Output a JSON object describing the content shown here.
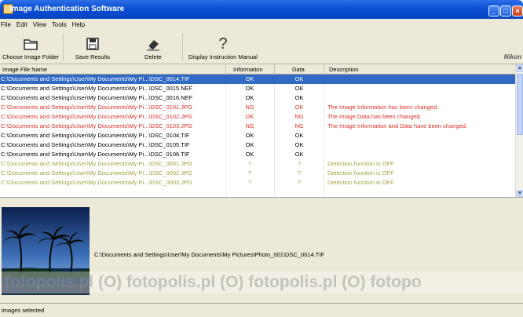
{
  "window": {
    "title": "Image Authentication Software"
  },
  "menu": [
    "File",
    "Edit",
    "View",
    "Tools",
    "Help"
  ],
  "toolbar": {
    "choose_folder": "Choose Image Folder",
    "save_results": "Save Results",
    "delete": "Delete",
    "manual": "Display Instruction Manual",
    "brand": "Nikon"
  },
  "table": {
    "columns": [
      "Image File Name",
      "Information",
      "Data",
      "Description"
    ],
    "rows": [
      {
        "name": "C:\\Documents and Settings\\User\\My Documents\\My Pi...\\DSC_0014.TIF",
        "info": "OK",
        "data": "OK",
        "desc": "",
        "status": "selected"
      },
      {
        "name": "C:\\Documents and Settings\\User\\My Documents\\My Pi...\\DSC_0015.NEF",
        "info": "OK",
        "data": "OK",
        "desc": "",
        "status": "normal"
      },
      {
        "name": "C:\\Documents and Settings\\User\\My Documents\\My Pi...\\DSC_0016.NEF",
        "info": "OK",
        "data": "OK",
        "desc": "",
        "status": "normal"
      },
      {
        "name": "C:\\Documents and Settings\\User\\My Documents\\My Pi...\\DSC_0101.JPG",
        "info": "NG",
        "data": "OK",
        "desc": "The Image Information has been changed.",
        "status": "red"
      },
      {
        "name": "C:\\Documents and Settings\\User\\My Documents\\My Pi...\\DSC_0102.JPG",
        "info": "OK",
        "data": "NG",
        "desc": "The Image Data has been changed.",
        "status": "red"
      },
      {
        "name": "C:\\Documents and Settings\\User\\My Documents\\My Pi...\\DSC_0103.JPG",
        "info": "NG",
        "data": "NG",
        "desc": "The Image Information and Data have been changed.",
        "status": "red"
      },
      {
        "name": "C:\\Documents and Settings\\User\\My Documents\\My Pi...\\DSC_0104.TIF",
        "info": "OK",
        "data": "OK",
        "desc": "",
        "status": "normal"
      },
      {
        "name": "C:\\Documents and Settings\\User\\My Documents\\My Pi...\\DSC_0105.TIF",
        "info": "OK",
        "data": "OK",
        "desc": "",
        "status": "normal"
      },
      {
        "name": "C:\\Documents and Settings\\User\\My Documents\\My Pi...\\DSC_0106.TIF",
        "info": "OK",
        "data": "OK",
        "desc": "",
        "status": "normal"
      },
      {
        "name": "C:\\Documents and Settings\\User\\My Documents\\My Pi...\\DSC_0001.JPG",
        "info": "?",
        "data": "?",
        "desc": "Detection function is OFF.",
        "status": "olive"
      },
      {
        "name": "C:\\Documents and Settings\\User\\My Documents\\My Pi...\\DSC_0002.JPG",
        "info": "?",
        "data": "?",
        "desc": "Detection function is OFF.",
        "status": "olive"
      },
      {
        "name": "C:\\Documents and Settings\\User\\My Documents\\My Pi...\\DSC_0003.JPG",
        "info": "?",
        "data": "?",
        "desc": "Detection function is OFF.",
        "status": "olive"
      }
    ]
  },
  "preview": {
    "path": "C:\\Documents and Settings\\User\\My Documents\\My Pictures\\Photo_001\\DSC_0014.TIF",
    "watermark": "fotopolis.pl  (O) fotopolis.pl  (O) fotopolis.pl  (O) fotopo"
  },
  "status": {
    "text": "images selected"
  },
  "colors": {
    "selected": "#316ac5",
    "error": "#e0302a",
    "off": "#a4a23d",
    "title": "#0a4fd6"
  },
  "icons": {
    "folder": "folder-icon",
    "save": "save-icon",
    "delete": "eraser-icon",
    "manual": "question-icon"
  }
}
